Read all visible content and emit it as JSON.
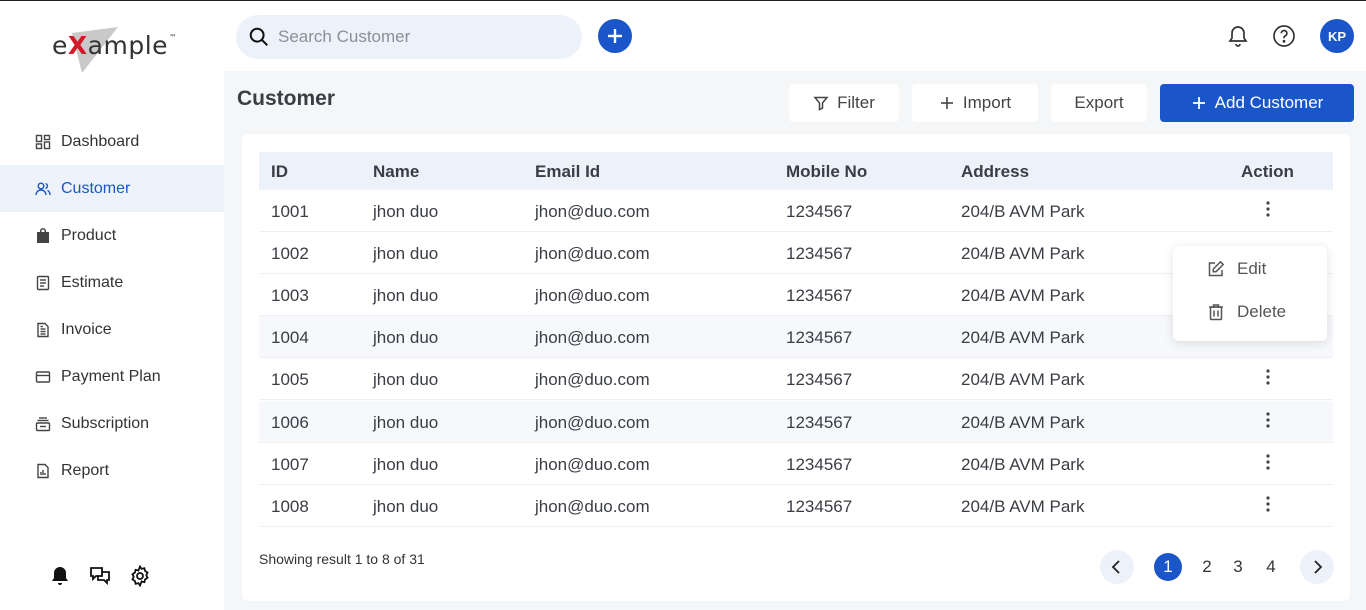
{
  "logo": {
    "text_pre": "e",
    "text_x": "X",
    "text_post": "ample",
    "tm": "™"
  },
  "sidebar": {
    "items": [
      {
        "label": "Dashboard",
        "icon": "dashboard-icon"
      },
      {
        "label": "Customer",
        "icon": "users-icon",
        "active": true
      },
      {
        "label": "Product",
        "icon": "bag-icon"
      },
      {
        "label": "Estimate",
        "icon": "document-icon"
      },
      {
        "label": "Invoice",
        "icon": "invoice-icon"
      },
      {
        "label": "Payment Plan",
        "icon": "card-icon"
      },
      {
        "label": "Subscription",
        "icon": "subscription-icon"
      },
      {
        "label": "Report",
        "icon": "report-icon"
      }
    ],
    "bottom_icons": [
      "bell-icon",
      "chat-icon",
      "gear-icon"
    ]
  },
  "topbar": {
    "search_placeholder": "Search Customer",
    "avatar_initials": "KP"
  },
  "page": {
    "title": "Customer",
    "filter_label": "Filter",
    "import_label": "Import",
    "export_label": "Export",
    "add_label": "Add Customer"
  },
  "table": {
    "headers": [
      "ID",
      "Name",
      "Email Id",
      "Mobile No",
      "Address",
      "Action"
    ],
    "rows": [
      [
        "1001",
        "jhon duo",
        "jhon@duo.com",
        "1234567",
        "204/B AVM Park"
      ],
      [
        "1002",
        "jhon duo",
        "jhon@duo.com",
        "1234567",
        "204/B AVM Park"
      ],
      [
        "1003",
        "jhon duo",
        "jhon@duo.com",
        "1234567",
        "204/B AVM Park"
      ],
      [
        "1004",
        "jhon duo",
        "jhon@duo.com",
        "1234567",
        "204/B AVM Park"
      ],
      [
        "1005",
        "jhon duo",
        "jhon@duo.com",
        "1234567",
        "204/B AVM Park"
      ],
      [
        "1006",
        "jhon duo",
        "jhon@duo.com",
        "1234567",
        "204/B AVM Park"
      ],
      [
        "1007",
        "jhon duo",
        "jhon@duo.com",
        "1234567",
        "204/B AVM Park"
      ],
      [
        "1008",
        "jhon duo",
        "jhon@duo.com",
        "1234567",
        "204/B AVM Park"
      ]
    ],
    "action_menu": {
      "edit_label": "Edit",
      "delete_label": "Delete"
    }
  },
  "footer": {
    "showing": "Showing result 1 to 8 of 31",
    "pages": [
      "1",
      "2",
      "3",
      "4"
    ],
    "current_page": "1"
  },
  "colors": {
    "accent": "#1a56c9",
    "header_bg": "#edf2fa",
    "logo_red": "#d11a2a"
  }
}
